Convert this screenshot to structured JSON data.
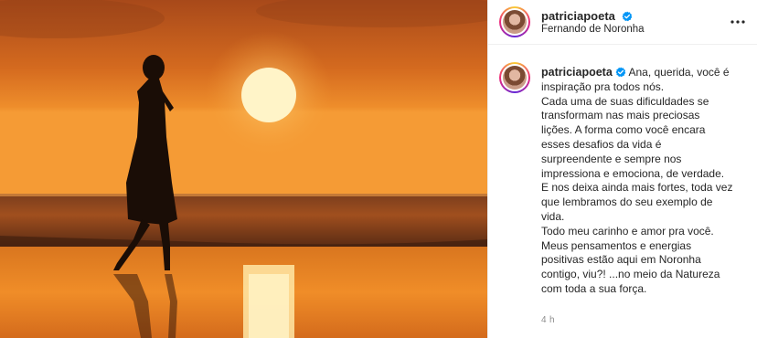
{
  "post": {
    "username": "patriciapoeta",
    "location": "Fernando de Noronha",
    "caption_lines": [
      "Ana, querida, você é",
      "inspiração pra todos nós.",
      "Cada uma de suas dificuldades se",
      "transformam nas mais preciosas",
      "lições. A forma como você encara",
      "esses desafios da vida é",
      "surpreendente e sempre nos",
      "impressiona e emociona, de verdade.",
      "E nos deixa ainda mais fortes, toda vez",
      "que lembramos do seu exemplo de",
      "vida.",
      "Todo meu carinho e amor pra você.",
      "Meus pensamentos e energias",
      "positivas estão aqui em Noronha",
      "contigo, viu?! ...no meio da Natureza",
      "com toda a sua força."
    ],
    "timestamp": "4 h"
  },
  "icons": {
    "verified": "verified-badge-icon",
    "more": "more-options-icon"
  },
  "colors": {
    "verified_blue": "#0095f6",
    "text": "#262626",
    "muted": "#8e8e8e",
    "sunset_orange": "#e98a28"
  }
}
